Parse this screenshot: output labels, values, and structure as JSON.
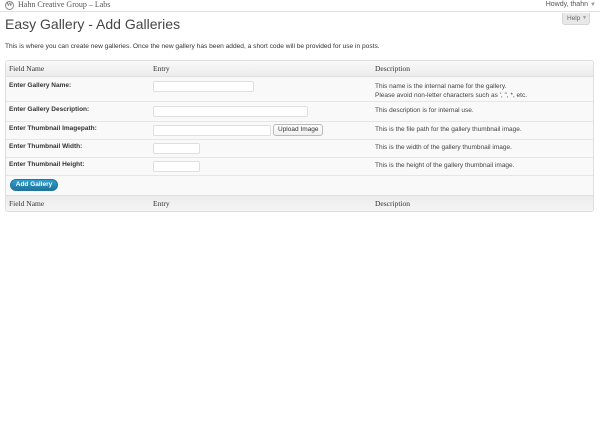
{
  "adminbar": {
    "site_name": "Hahn Creative Group – Labs",
    "howdy": "Howdy, thahn",
    "howdy_arrow": "▼"
  },
  "help": {
    "label": "Help",
    "arrow": "▼"
  },
  "page": {
    "title": "Easy Gallery - Add Galleries",
    "intro": "This is where you can create new galleries. Once the new gallery has been added, a short code will be provided for use in posts."
  },
  "table": {
    "columns": [
      "Field Name",
      "Entry",
      "Description"
    ],
    "rows": [
      {
        "label": "Enter Gallery Name:",
        "desc1": "This name is the internal name for the gallery.",
        "desc2": "Please avoid non-letter characters such as ', \", *, etc."
      },
      {
        "label": "Enter Gallery Description:",
        "desc1": "This description is for internal use."
      },
      {
        "label": "Enter Thumbnail Imagepath:",
        "desc1": "This is the file path for the gallery thumbnail image.",
        "button": "Upload Image"
      },
      {
        "label": "Enter Thumbnail Width:",
        "desc1": "This is the width of the gallery thumbnail image."
      },
      {
        "label": "Enter Thumbnail Height:",
        "desc1": "This is the height of the gallery thumbnail image."
      }
    ],
    "submit": "Add Gallery"
  },
  "colors": {
    "primary_button": "#21759b",
    "border": "#dfdfdf"
  }
}
